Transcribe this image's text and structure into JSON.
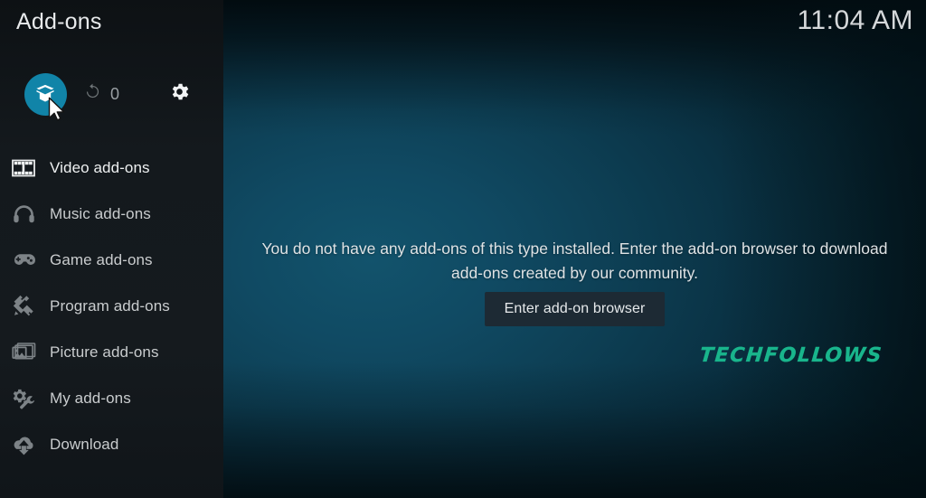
{
  "window": {
    "title": "Add-ons",
    "clock": "11:04 AM"
  },
  "toolbar": {
    "addons_icon": "open-box-icon",
    "addons_label": "Add-on browser",
    "updates_icon": "refresh-icon",
    "updates_count": "0",
    "settings_icon": "gear-icon",
    "settings_label": "Settings"
  },
  "sidebar": {
    "items": [
      {
        "label": "Video add-ons",
        "icon": "film-strip-icon",
        "active": true
      },
      {
        "label": "Music add-ons",
        "icon": "headphones-icon",
        "active": false
      },
      {
        "label": "Game add-ons",
        "icon": "gamepad-icon",
        "active": false
      },
      {
        "label": "Program add-ons",
        "icon": "pencil-ruler-icon",
        "active": false
      },
      {
        "label": "Picture add-ons",
        "icon": "picture-icon",
        "active": false
      },
      {
        "label": "My add-ons",
        "icon": "gear-wrench-icon",
        "active": false
      },
      {
        "label": "Download",
        "icon": "download-cloud-icon",
        "active": false
      }
    ]
  },
  "main": {
    "empty_message": "You do not have any add-ons of this type installed. Enter the add-on browser to download add-ons created by our community.",
    "browser_button": "Enter add-on browser",
    "watermark": "TECHFOLLOWS"
  },
  "colors": {
    "accent_teal": "#1184a8",
    "background_teal": "#104a63",
    "sidebar": "#14191d",
    "button": "#1d2a34",
    "watermark": "#19b58c",
    "text_primary": "#e8eaec",
    "text_menu": "#c9ccce"
  }
}
